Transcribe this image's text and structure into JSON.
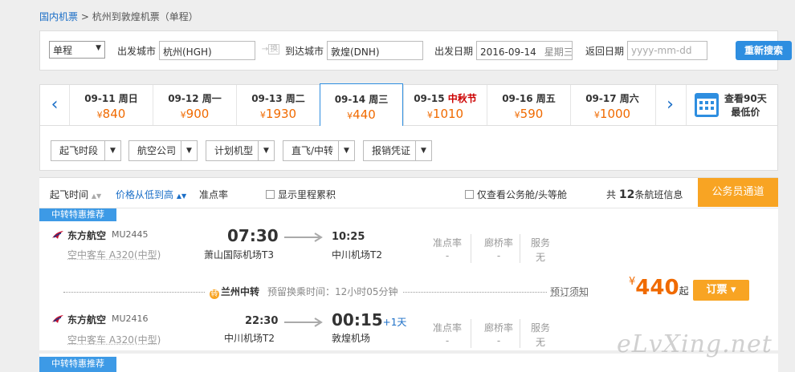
{
  "breadcrumb": {
    "root": "国内机票",
    "sep": " > ",
    "current": "杭州到敦煌机票（单程）"
  },
  "search": {
    "trip_type": "单程",
    "from_label": "出发城市",
    "from_value": "杭州(HGH)",
    "swap_label": "换",
    "to_label": "到达城市",
    "to_value": "敦煌(DNH)",
    "depart_label": "出发日期",
    "depart_value": "2016-09-14",
    "depart_week": "星期三",
    "return_label": "返回日期",
    "return_placeholder": "yyyy-mm-dd",
    "search_button": "重新搜索"
  },
  "dates": [
    {
      "date": "09-11",
      "week": "周日",
      "festival": "",
      "price": "840"
    },
    {
      "date": "09-12",
      "week": "周一",
      "festival": "",
      "price": "900"
    },
    {
      "date": "09-13",
      "week": "周二",
      "festival": "",
      "price": "1930"
    },
    {
      "date": "09-14",
      "week": "周三",
      "festival": "",
      "price": "440"
    },
    {
      "date": "09-15",
      "week": "",
      "festival": "中秋节",
      "price": "1010"
    },
    {
      "date": "09-16",
      "week": "周五",
      "festival": "",
      "price": "590"
    },
    {
      "date": "09-17",
      "week": "周六",
      "festival": "",
      "price": "1000"
    }
  ],
  "currency": "¥",
  "calendar": {
    "line1": "查看90天",
    "line2": "最低价"
  },
  "filters": [
    "起飞时段",
    "航空公司",
    "计划机型",
    "直飞/中转",
    "报销凭证"
  ],
  "sort": {
    "depart_time": "起飞时间",
    "price_low_high": "价格从低到高",
    "on_time": "准点率",
    "show_mileage": "显示里程累积",
    "business_only": "仅查看公务舱/头等舱",
    "count_prefix": "共",
    "count": "12",
    "count_suffix": "条航班信息",
    "civil_button": "公务员通道"
  },
  "results": [
    {
      "tag": "中转特惠推荐",
      "legs": [
        {
          "airline": "东方航空",
          "flight_no": "MU2445",
          "plane": "空中客车 A320(中型)",
          "dep_time": "07:30",
          "dep_airport": "萧山国际机场T3",
          "arr_time": "10:25",
          "arr_airport": "中川机场T2",
          "plus_day": "",
          "on_time_label": "准点率",
          "on_time": "-",
          "bridge_label": "廊桥率",
          "bridge": "-",
          "service_label": "服务",
          "service": "无"
        },
        {
          "airline": "东方航空",
          "flight_no": "MU2416",
          "plane": "空中客车 A320(中型)",
          "dep_time": "22:30",
          "dep_airport": "中川机场T2",
          "arr_time": "00:15",
          "arr_airport": "敦煌机场",
          "plus_day": "+1天",
          "on_time_label": "准点率",
          "on_time": "-",
          "bridge_label": "廊桥率",
          "bridge": "-",
          "service_label": "服务",
          "service": "无"
        }
      ],
      "transfer_icon": "转",
      "transfer_city": "兰州中转",
      "transfer_wait": "预留换乘时间：12小时05分钟",
      "notice": "预订须知",
      "price": "440",
      "price_suffix": "起",
      "book_button": "订票 ▾"
    },
    {
      "tag": "中转特惠推荐"
    }
  ],
  "watermark": "eLvXing.net",
  "colors": {
    "accent": "#2e8ee0",
    "orange": "#f06a00",
    "button_orange": "#f8a423",
    "festival": "#cc0000"
  }
}
